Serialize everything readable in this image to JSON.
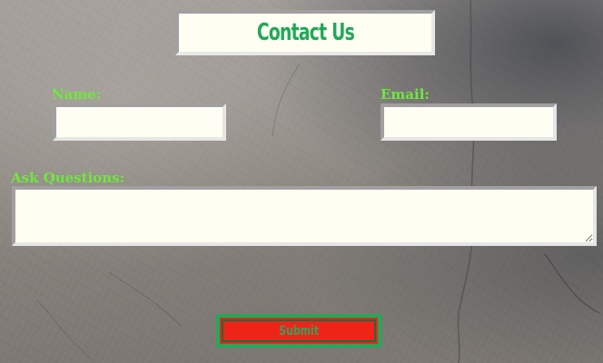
{
  "form": {
    "title": "Contact Us",
    "name_label": "Name:",
    "email_label": "Email:",
    "questions_label": "Ask Questions:",
    "name_value": "",
    "email_value": "",
    "questions_value": "",
    "submit_label": "Submit"
  },
  "colors": {
    "title_text": "#22a85a",
    "label_text": "#6fe83c",
    "field_background": "#fefef2",
    "submit_background": "#ef2418",
    "submit_border": "#24a85a"
  }
}
